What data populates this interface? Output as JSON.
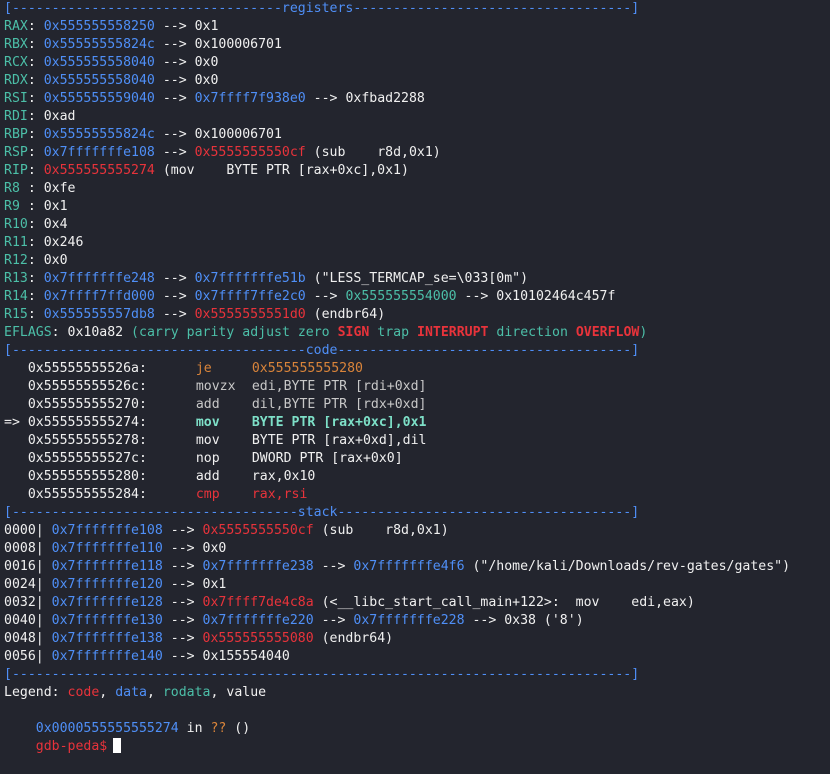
{
  "sections": {
    "registers": "[----------------------------------registers-----------------------------------]",
    "code": "[-------------------------------------code-------------------------------------]",
    "stack": "[------------------------------------stack-------------------------------------]",
    "end": "[------------------------------------------------------------------------------]"
  },
  "registers": [
    {
      "name": "RAX",
      "sep": ": ",
      "segs": [
        {
          "t": "0x555555558250",
          "c": "blue"
        },
        {
          "t": " --> ",
          "c": "white"
        },
        {
          "t": "0x1",
          "c": "white"
        }
      ]
    },
    {
      "name": "RBX",
      "sep": ": ",
      "segs": [
        {
          "t": "0x55555555824c",
          "c": "blue"
        },
        {
          "t": " --> ",
          "c": "white"
        },
        {
          "t": "0x100006701",
          "c": "white"
        }
      ]
    },
    {
      "name": "RCX",
      "sep": ": ",
      "segs": [
        {
          "t": "0x555555558040",
          "c": "blue"
        },
        {
          "t": " --> ",
          "c": "white"
        },
        {
          "t": "0x0",
          "c": "white"
        }
      ]
    },
    {
      "name": "RDX",
      "sep": ": ",
      "segs": [
        {
          "t": "0x555555558040",
          "c": "blue"
        },
        {
          "t": " --> ",
          "c": "white"
        },
        {
          "t": "0x0",
          "c": "white"
        }
      ]
    },
    {
      "name": "RSI",
      "sep": ": ",
      "segs": [
        {
          "t": "0x555555559040",
          "c": "blue"
        },
        {
          "t": " --> ",
          "c": "white"
        },
        {
          "t": "0x7ffff7f938e0",
          "c": "blue"
        },
        {
          "t": " --> ",
          "c": "white"
        },
        {
          "t": "0xfbad2288",
          "c": "white"
        }
      ]
    },
    {
      "name": "RDI",
      "sep": ": ",
      "segs": [
        {
          "t": "0xad",
          "c": "white"
        }
      ]
    },
    {
      "name": "RBP",
      "sep": ": ",
      "segs": [
        {
          "t": "0x55555555824c",
          "c": "blue"
        },
        {
          "t": " --> ",
          "c": "white"
        },
        {
          "t": "0x100006701",
          "c": "white"
        }
      ]
    },
    {
      "name": "RSP",
      "sep": ": ",
      "segs": [
        {
          "t": "0x7fffffffe108",
          "c": "blue"
        },
        {
          "t": " --> ",
          "c": "white"
        },
        {
          "t": "0x5555555550cf",
          "c": "red"
        },
        {
          "t": " (sub    r8d,0x1)",
          "c": "white"
        }
      ]
    },
    {
      "name": "RIP",
      "sep": ": ",
      "segs": [
        {
          "t": "0x555555555274",
          "c": "red"
        },
        {
          "t": " (mov    BYTE PTR [rax+0xc],0x1)",
          "c": "white"
        }
      ]
    },
    {
      "name": "R8",
      "sep": " : ",
      "segs": [
        {
          "t": "0xfe",
          "c": "white"
        }
      ]
    },
    {
      "name": "R9",
      "sep": " : ",
      "segs": [
        {
          "t": "0x1",
          "c": "white"
        }
      ]
    },
    {
      "name": "R10",
      "sep": ": ",
      "segs": [
        {
          "t": "0x4",
          "c": "white"
        }
      ]
    },
    {
      "name": "R11",
      "sep": ": ",
      "segs": [
        {
          "t": "0x246",
          "c": "white"
        }
      ]
    },
    {
      "name": "R12",
      "sep": ": ",
      "segs": [
        {
          "t": "0x0",
          "c": "white"
        }
      ]
    },
    {
      "name": "R13",
      "sep": ": ",
      "segs": [
        {
          "t": "0x7fffffffe248",
          "c": "blue"
        },
        {
          "t": " --> ",
          "c": "white"
        },
        {
          "t": "0x7fffffffe51b",
          "c": "blue"
        },
        {
          "t": " (\"LESS_TERMCAP_se=\\033[0m\")",
          "c": "white"
        }
      ]
    },
    {
      "name": "R14",
      "sep": ": ",
      "segs": [
        {
          "t": "0x7ffff7ffd000",
          "c": "blue"
        },
        {
          "t": " --> ",
          "c": "white"
        },
        {
          "t": "0x7ffff7ffe2c0",
          "c": "blue"
        },
        {
          "t": " --> ",
          "c": "white"
        },
        {
          "t": "0x555555554000",
          "c": "green"
        },
        {
          "t": " --> ",
          "c": "white"
        },
        {
          "t": "0x10102464c457f",
          "c": "white"
        }
      ]
    },
    {
      "name": "R15",
      "sep": ": ",
      "segs": [
        {
          "t": "0x555555557db8",
          "c": "blue"
        },
        {
          "t": " --> ",
          "c": "white"
        },
        {
          "t": "0x5555555551d0",
          "c": "red"
        },
        {
          "t": " (endbr64)",
          "c": "white"
        }
      ]
    }
  ],
  "eflags": {
    "label": "EFLAGS",
    "value": "0x10a82",
    "flags": [
      {
        "t": "carry",
        "c": "green"
      },
      {
        "t": "parity",
        "c": "green"
      },
      {
        "t": "adjust",
        "c": "green"
      },
      {
        "t": "zero",
        "c": "green"
      },
      {
        "t": "SIGN",
        "c": "red"
      },
      {
        "t": "trap",
        "c": "green"
      },
      {
        "t": "INTERRUPT",
        "c": "red"
      },
      {
        "t": "direction",
        "c": "green"
      },
      {
        "t": "OVERFLOW",
        "c": "red"
      }
    ]
  },
  "code": [
    {
      "prefix": "   ",
      "addr": "0x55555555526a:",
      "mnem": "je",
      "ops": "0x555555555280",
      "style": "orange"
    },
    {
      "prefix": "   ",
      "addr": "0x55555555526c:",
      "mnem": "movzx",
      "ops": "edi,BYTE PTR [rdi+0xd]",
      "style": "grey"
    },
    {
      "prefix": "   ",
      "addr": "0x555555555270:",
      "mnem": "add",
      "ops": "dil,BYTE PTR [rdx+0xd]",
      "style": "grey"
    },
    {
      "prefix": "=> ",
      "addr": "0x555555555274:",
      "mnem": "mov",
      "ops": "BYTE PTR [rax+0xc],0x1",
      "style": "cur"
    },
    {
      "prefix": "   ",
      "addr": "0x555555555278:",
      "mnem": "mov",
      "ops": "BYTE PTR [rax+0xd],dil",
      "style": "white"
    },
    {
      "prefix": "   ",
      "addr": "0x55555555527c:",
      "mnem": "nop",
      "ops": "DWORD PTR [rax+0x0]",
      "style": "white"
    },
    {
      "prefix": "   ",
      "addr": "0x555555555280:",
      "mnem": "add",
      "ops": "rax,0x10",
      "style": "white"
    },
    {
      "prefix": "   ",
      "addr": "0x555555555284:",
      "mnem": "cmp",
      "ops": "rax,rsi",
      "style": "red"
    }
  ],
  "stack": [
    {
      "off": "0000|",
      "segs": [
        {
          "t": "0x7fffffffe108",
          "c": "blue"
        },
        {
          "t": " --> ",
          "c": "white"
        },
        {
          "t": "0x5555555550cf",
          "c": "red"
        },
        {
          "t": " (sub    r8d,0x1)",
          "c": "white"
        }
      ]
    },
    {
      "off": "0008|",
      "segs": [
        {
          "t": "0x7fffffffe110",
          "c": "blue"
        },
        {
          "t": " --> ",
          "c": "white"
        },
        {
          "t": "0x0",
          "c": "white"
        }
      ]
    },
    {
      "off": "0016|",
      "segs": [
        {
          "t": "0x7fffffffe118",
          "c": "blue"
        },
        {
          "t": " --> ",
          "c": "white"
        },
        {
          "t": "0x7fffffffe238",
          "c": "blue"
        },
        {
          "t": " --> ",
          "c": "white"
        },
        {
          "t": "0x7fffffffe4f6",
          "c": "blue"
        },
        {
          "t": " (\"/home/kali/Downloads/rev-gates/gates\")",
          "c": "white"
        }
      ]
    },
    {
      "off": "0024|",
      "segs": [
        {
          "t": "0x7fffffffe120",
          "c": "blue"
        },
        {
          "t": " --> ",
          "c": "white"
        },
        {
          "t": "0x1",
          "c": "white"
        }
      ]
    },
    {
      "off": "0032|",
      "segs": [
        {
          "t": "0x7fffffffe128",
          "c": "blue"
        },
        {
          "t": " --> ",
          "c": "white"
        },
        {
          "t": "0x7ffff7de4c8a",
          "c": "red"
        },
        {
          "t": " (<__libc_start_call_main+122>:  mov    edi,eax)",
          "c": "white"
        }
      ]
    },
    {
      "off": "0040|",
      "segs": [
        {
          "t": "0x7fffffffe130",
          "c": "blue"
        },
        {
          "t": " --> ",
          "c": "white"
        },
        {
          "t": "0x7fffffffe220",
          "c": "blue"
        },
        {
          "t": " --> ",
          "c": "white"
        },
        {
          "t": "0x7fffffffe228",
          "c": "blue"
        },
        {
          "t": " --> ",
          "c": "white"
        },
        {
          "t": "0x38 ('8')",
          "c": "white"
        }
      ]
    },
    {
      "off": "0048|",
      "segs": [
        {
          "t": "0x7fffffffe138",
          "c": "blue"
        },
        {
          "t": " --> ",
          "c": "white"
        },
        {
          "t": "0x555555555080",
          "c": "red"
        },
        {
          "t": " (endbr64)",
          "c": "white"
        }
      ]
    },
    {
      "off": "0056|",
      "segs": [
        {
          "t": "0x7fffffffe140",
          "c": "blue"
        },
        {
          "t": " --> ",
          "c": "white"
        },
        {
          "t": "0x155554040",
          "c": "white"
        }
      ]
    }
  ],
  "legend": {
    "label": "Legend: ",
    "items": [
      {
        "t": "code",
        "c": "red"
      },
      {
        "t": "data",
        "c": "blue"
      },
      {
        "t": "rodata",
        "c": "green"
      },
      {
        "t": "value",
        "c": "white"
      }
    ]
  },
  "location": {
    "addr": "0x0000555555555274",
    "in": " in ",
    "func": "??",
    "tail": " ()"
  },
  "prompt": "gdb-peda$",
  "colors": {
    "background": "#23252e",
    "blue": "#4f8ff7",
    "red": "#e8333b",
    "green": "#4cbfa8",
    "orange": "#d9843a"
  }
}
